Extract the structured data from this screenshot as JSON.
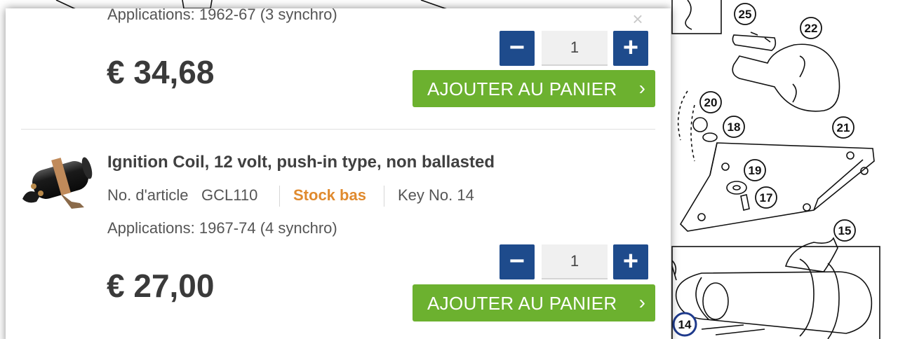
{
  "popup": {
    "close_label": "×",
    "products": [
      {
        "applications": "Applications: 1962-67 (3 synchro)",
        "price": "€ 34,68",
        "quantity": "1"
      },
      {
        "title": "Ignition Coil, 12 volt, push-in type, non ballasted",
        "article_label": "No. d'article",
        "article_number": "GCL110",
        "stock_status": "Stock bas",
        "key_no": "Key No. 14",
        "applications": "Applications: 1967-74 (4 synchro)",
        "price": "€ 27,00",
        "quantity": "1"
      }
    ],
    "controls": {
      "minus": "−",
      "plus": "+",
      "add_to_cart": "AJOUTER AU PANIER",
      "chevron": "›"
    }
  },
  "diagram": {
    "callouts": [
      "25",
      "22",
      "20",
      "18",
      "21",
      "19",
      "17",
      "15",
      "14"
    ]
  },
  "colors": {
    "qty_button": "#1e4b8c",
    "cart_button": "#6cb12f",
    "stock_low": "#e08a2e",
    "price_text": "#3a3a3a"
  }
}
